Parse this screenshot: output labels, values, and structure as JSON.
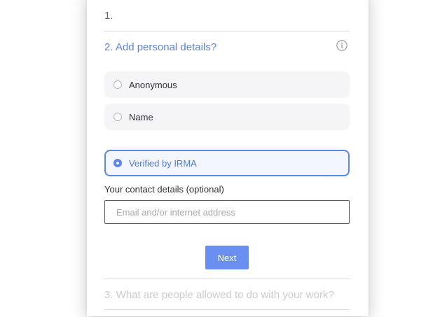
{
  "form": {
    "step1_label": "1.",
    "step2_title": "2. Add personal details?",
    "options": [
      {
        "label": "Anonymous",
        "selected": false
      },
      {
        "label": "Name",
        "selected": false
      },
      {
        "label": "Verified by IRMA",
        "selected": true
      }
    ],
    "contact_label": "Your contact details (optional)",
    "contact_placeholder": "Email and/or internet address",
    "contact_value": "",
    "next_label": "Next",
    "step3_title": "3. What are people allowed to do with your work?"
  },
  "colors": {
    "accent": "#5b86ea",
    "button": "#6b8ff0",
    "option_bg": "#f5f5f7",
    "text": "#2f3136",
    "muted": "#c9cbcf"
  },
  "icons": {
    "info": "info-icon"
  }
}
